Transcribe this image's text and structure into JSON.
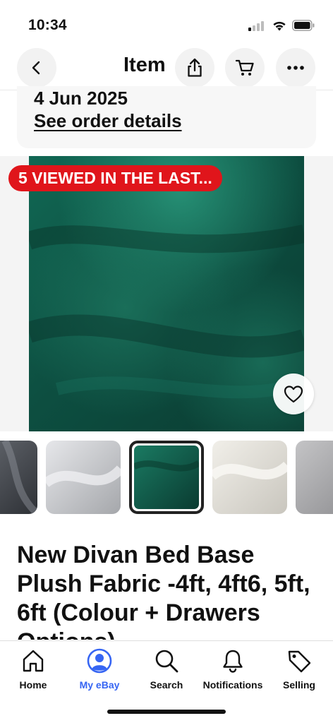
{
  "status_bar": {
    "time": "10:34"
  },
  "header": {
    "title": "Item",
    "icons": [
      "back-arrow-icon",
      "share-icon",
      "cart-icon",
      "more-icon"
    ]
  },
  "order": {
    "date": "4 Jun 2025",
    "details_link": "See order details"
  },
  "listing": {
    "views_badge": "5 VIEWED IN THE LAST...",
    "title": "New Divan Bed Base Plush Fabric -4ft, 4ft6, 5ft, 6ft (Colour + Drawers Options)",
    "selected_thumbnail": 3,
    "thumbnail_colors": [
      "#4a4e55",
      "#c9cacd",
      "#0f5a48",
      "#e2e0da",
      "#a9a9ab"
    ]
  },
  "tabs": [
    {
      "label": "Home",
      "icon": "home-icon",
      "active": false
    },
    {
      "label": "My eBay",
      "icon": "profile-icon",
      "active": true
    },
    {
      "label": "Search",
      "icon": "search-icon",
      "active": false
    },
    {
      "label": "Notifications",
      "icon": "bell-icon",
      "active": false
    },
    {
      "label": "Selling",
      "icon": "tag-icon",
      "active": false
    }
  ],
  "colors": {
    "accent": "#3665f3",
    "badge_red": "#e0151b",
    "fabric_green": "#0f5a48"
  }
}
